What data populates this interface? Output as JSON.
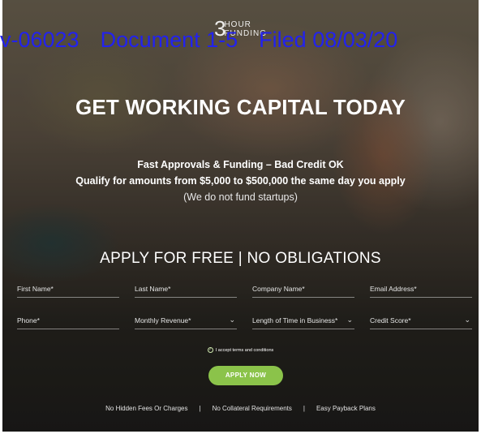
{
  "logo": {
    "number": "3",
    "line1": "HOUR",
    "line2": "FUNDING"
  },
  "stamp": {
    "case_no": "v-06023",
    "document": "Document 1-5",
    "filed": "Filed 08/03/20"
  },
  "hero": {
    "headline": "GET WORKING CAPITAL TODAY",
    "sub1": "Fast Approvals & Funding – Bad Credit OK",
    "sub2": "Qualify for amounts from $5,000 to $500,000 the same day you apply",
    "sub3": "(We do not fund startups)"
  },
  "form": {
    "title": "APPLY FOR FREE | NO OBLIGATIONS",
    "first_name": "First Name*",
    "last_name": "Last Name*",
    "company_name": "Company Name*",
    "email": "Email Address*",
    "phone": "Phone*",
    "monthly_revenue": "Monthly Revenue*",
    "time_in_business": "Length of Time in Business*",
    "credit_score": "Credit Score*",
    "terms": "I accept terms and conditions",
    "submit": "APPLY NOW"
  },
  "features": [
    "No Hidden Fees Or Charges",
    "No Collateral Requirements",
    "Easy Payback Plans"
  ],
  "features_separator": "|",
  "colors": {
    "button": "#8bc34a",
    "stamp": "#2222ee"
  },
  "icons": {
    "dropdown": "chevron-down-icon",
    "checkbox": "check-circle-icon"
  }
}
